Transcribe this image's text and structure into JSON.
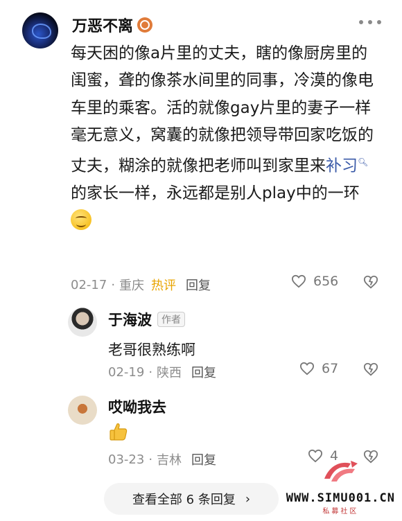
{
  "main_comment": {
    "user": "万恶不离",
    "text_parts": [
      "每天困的像a片里的丈夫，瞎的像厨房里的闺蜜，聋的像茶水间里的同事，冷漠的像电车里的乘客。活的就像gay片里的妻子一样毫无意义，窝囊的就像把领导带回家吃饭的丈夫，糊涂的就像把老师叫到家里来",
      "补习",
      "的家长一样，永远都是别人play中的一环"
    ],
    "date": "02-17",
    "location": "重庆",
    "hot_label": "热评",
    "reply_label": "回复",
    "likes": "656"
  },
  "replies": [
    {
      "user": "于海波",
      "tag": "作者",
      "text": "老哥很熟练啊",
      "date": "02-19",
      "location": "陕西",
      "reply_label": "回复",
      "likes": "67"
    },
    {
      "user": "哎呦我去",
      "text": "",
      "date": "03-23",
      "location": "吉林",
      "reply_label": "回复",
      "likes": "4"
    }
  ],
  "view_all": {
    "label": "查看全部 6 条回复",
    "chevron": "›"
  },
  "watermark": {
    "site": "WWW.SIMU001.CN",
    "sub": "私募社区"
  },
  "separator": "·",
  "colors": {
    "hot": "#e8a400",
    "link": "#3a5aa8",
    "meta": "#8c8c8c"
  },
  "icons": [
    "more-icon",
    "badge-icon",
    "search-icon",
    "smile-emoji-icon",
    "heart-icon",
    "dislike-icon",
    "thumbs-up-icon",
    "watermark-logo-icon"
  ]
}
